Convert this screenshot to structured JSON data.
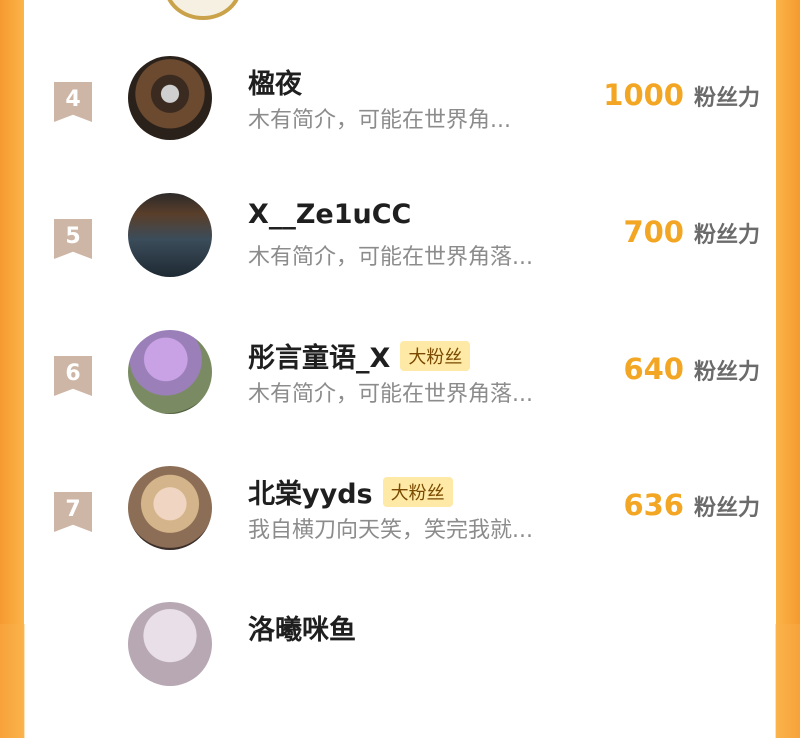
{
  "colors": {
    "accent": "#f3a623",
    "frame": "#f7a23a",
    "rank_badge": "#ceb6a6",
    "fan_badge_bg": "#ffe9a6"
  },
  "fans_label": "粉丝力",
  "rows": [
    {
      "rank": "4",
      "name": "楹夜",
      "badge": "",
      "bio": "木有简介，可能在世界角...",
      "fans": "1000"
    },
    {
      "rank": "5",
      "name": "X__Ze1uCC",
      "badge": "",
      "bio": "木有简介，可能在世界角落...",
      "fans": "700"
    },
    {
      "rank": "6",
      "name": "彤言童语_X",
      "badge": "大粉丝",
      "bio": "木有简介，可能在世界角落...",
      "fans": "640"
    },
    {
      "rank": "7",
      "name": "北棠yyds",
      "badge": "大粉丝",
      "bio": "我自横刀向天笑，笑完我就...",
      "fans": "636"
    },
    {
      "rank": "",
      "name": "洛曦咪鱼",
      "badge": "",
      "bio": "",
      "fans": ""
    }
  ]
}
